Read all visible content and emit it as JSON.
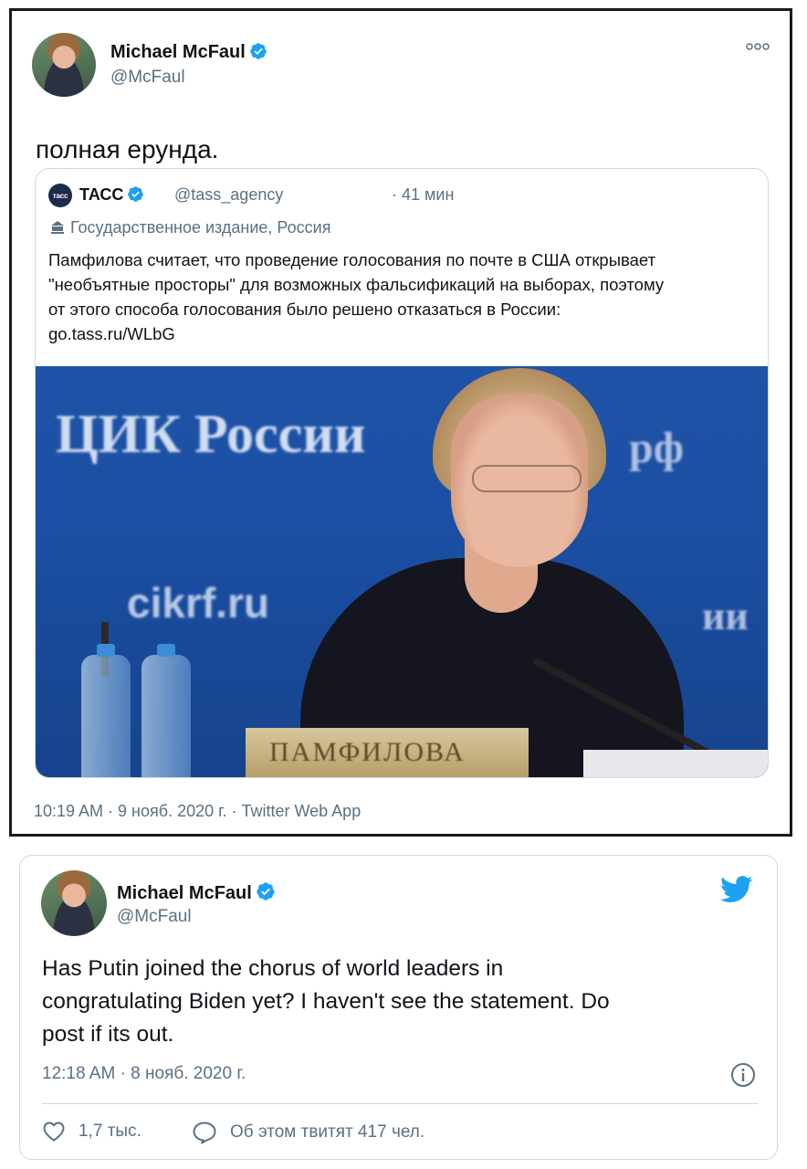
{
  "tweet1": {
    "author_name": "Michael McFaul",
    "author_handle": "@McFaul",
    "text": "полная ерунда.",
    "quoted": {
      "logo_text": "тасс",
      "author_name": "ТАСС",
      "author_handle": "@tass_agency",
      "time": "· 41 мин",
      "label": "Государственное издание, Россия",
      "body_lines": [
        "Памфилова считает, что проведение голосования по почте в США открывает",
        "\"необъятные просторы\" для возможных фальсификаций на выборах, поэтому",
        "от этого способа голосования было решено отказаться в России:",
        "go.tass.ru/WLbG"
      ],
      "photo_text": {
        "banner": "ЦИК России",
        "site": "cikrf.ru",
        "right_top": "рф",
        "right_mid": "ии",
        "nameplate": "ПАМФИЛОВА"
      }
    },
    "meta": "10:19 AM · 9 нояб. 2020 г. · Twitter Web App",
    "icons": {
      "verified": "verified-badge-icon",
      "more": "more-icon",
      "state_media": "government-building-icon"
    }
  },
  "tweet2": {
    "author_name": "Michael McFaul",
    "author_handle": "@McFaul",
    "text_lines": [
      "Has Putin joined the chorus of world leaders in",
      "congratulating Biden yet? I haven't see the statement. Do",
      "post if its out."
    ],
    "meta": "12:18 AM · 8 нояб. 2020 г.",
    "likes": "1,7 тыс.",
    "retweet_talk": "Об этом твитят 417 чел.",
    "icons": {
      "brand": "twitter-bird-icon",
      "info": "info-icon",
      "like": "heart-icon",
      "reply": "comment-icon"
    }
  },
  "colors": {
    "twitter_blue": "#1da1f2",
    "secondary_text": "#5b7083",
    "border": "#cfd9de"
  }
}
